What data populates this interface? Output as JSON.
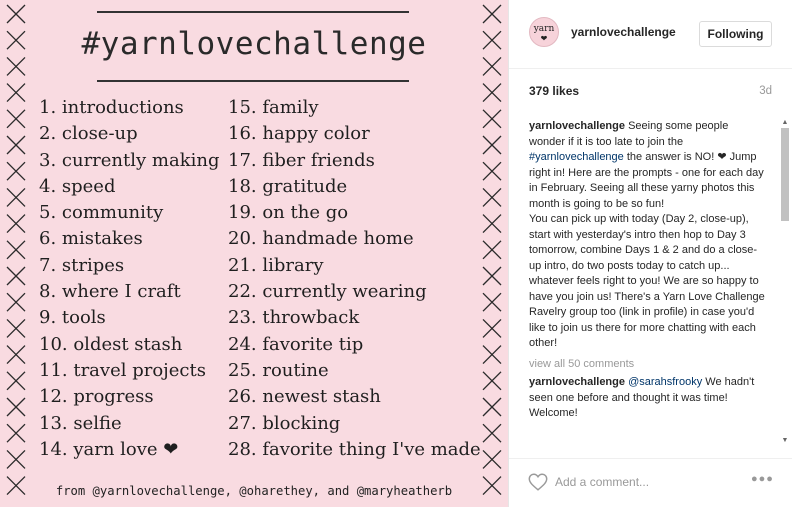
{
  "image": {
    "title": "#yarnlovechallenge",
    "prompts_col1": [
      "1. introductions",
      "2. close-up",
      "3. currently making",
      "4. speed",
      "5. community",
      "6. mistakes",
      "7. stripes",
      "8. where I craft",
      "9. tools",
      "10. oldest stash",
      "11. travel projects",
      "12. progress",
      "13. selfie",
      "14. yarn love ❤"
    ],
    "prompts_col2": [
      "15. family",
      "16. happy color",
      "17. fiber friends",
      "18. gratitude",
      "19. on the go",
      "20. handmade home",
      "21. library",
      "22. currently wearing",
      "23. throwback",
      "24. favorite tip",
      "25. routine",
      "26. newest stash",
      "27. blocking",
      "28. favorite thing I've made"
    ],
    "credit": "from @yarnlovechallenge, @oharethey, and @maryheatherb",
    "background_color": "#f9dbe1"
  },
  "header": {
    "avatar_text": "yarn",
    "avatar_heart": "❤",
    "username": "yarnlovechallenge",
    "follow_label": "Following"
  },
  "meta": {
    "likes": "379 likes",
    "time_ago": "3d"
  },
  "caption": {
    "username": "yarnlovechallenge",
    "text_before_tag": "Seeing some people wonder if it is too late to join the",
    "hashtag": "#yarnlovechallenge",
    "text_after_tag": "the answer is NO! ❤ Jump right in! Here are the prompts - one for each day in February. Seeing all these yarny photos this month is going to be so fun!",
    "paragraph2": "You can pick up with today (Day 2, close-up), start with yesterday's intro then hop to Day 3 tomorrow, combine Days 1 & 2 and do a close-up intro, do two posts today to catch up... whatever feels right to you! We are so happy to have you join us! There's a Yarn Love Challenge Ravelry group too (link in profile) in case you'd like to join us there for more chatting with each other!"
  },
  "view_all": "view all 50 comments",
  "comments": [
    {
      "username": "yarnlovechallenge",
      "mention": "@sarahsfrooky",
      "text": "We hadn't seen one before and thought it was time! Welcome!"
    }
  ],
  "comment_input": {
    "placeholder": "Add a comment..."
  },
  "icons": {
    "like": "heart-outline-icon",
    "more": "more-options-icon"
  },
  "colors": {
    "link": "#003569",
    "muted": "#999999"
  }
}
